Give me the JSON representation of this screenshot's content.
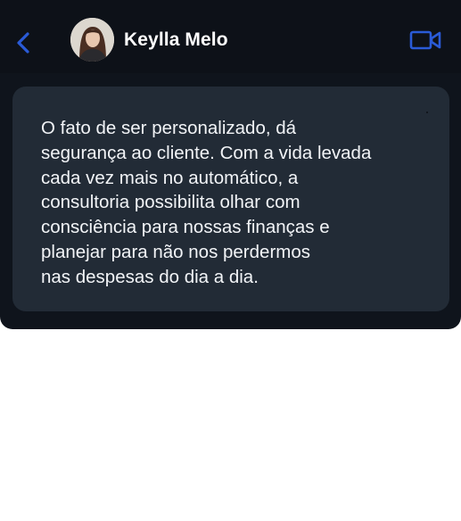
{
  "header": {
    "contact_name": "Keylla Melo",
    "back_icon": "chevron-left-icon",
    "video_icon": "video-camera-icon",
    "accent_color": "#2a5bd7"
  },
  "message": {
    "text": "O fato de ser personalizado, dá\nsegurança ao cliente. Com a vida levada\ncada vez mais no automático, a\nconsultoria possibilita olhar com\nconsciência para nossas finanças e\nplanejar para não nos perdermos\nnas despesas do dia a dia."
  },
  "colors": {
    "card_background": "#0f141c",
    "bubble_background": "#222b36",
    "text": "#f2f4f7"
  }
}
